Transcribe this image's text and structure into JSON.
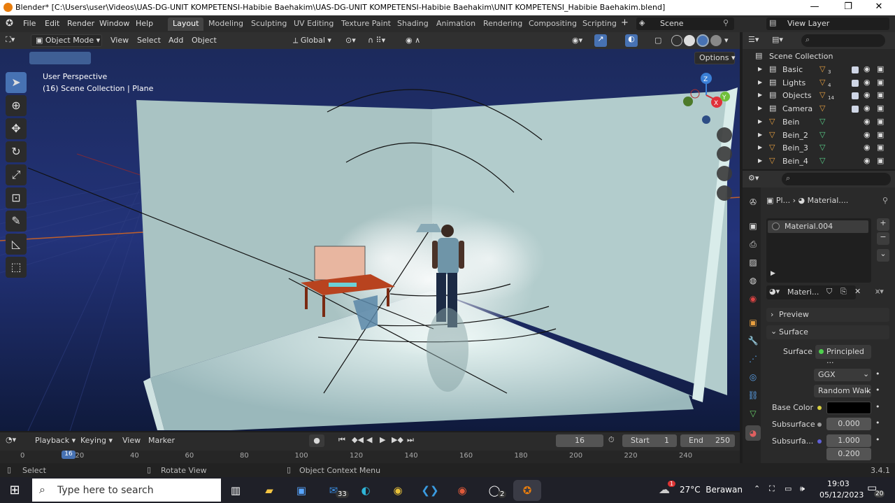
{
  "titlebar": {
    "title": "Blender* [C:\\Users\\user\\Videos\\UAS-DG-UNIT KOMPETENSI-Habibie Baehakim\\UAS-DG-UNIT KOMPETENSI-Habibie Baehakim\\UNIT KOMPETENSI_Habibie Baehakim.blend]",
    "minimize": "—",
    "restore": "❐",
    "close": "✕"
  },
  "menubar": {
    "menus": [
      "File",
      "Edit",
      "Render",
      "Window",
      "Help"
    ],
    "workspaces": [
      "Layout",
      "Modeling",
      "Sculpting",
      "UV Editing",
      "Texture Paint",
      "Shading",
      "Animation",
      "Rendering",
      "Compositing",
      "Scripting"
    ],
    "active_workspace": "Layout",
    "add_workspace": "+",
    "scene": "Scene",
    "view_layer": "View Layer"
  },
  "viewport_header": {
    "mode": "Object Mode",
    "menus": [
      "View",
      "Select",
      "Add",
      "Object"
    ],
    "transform_orientation": "Global",
    "options": "Options"
  },
  "viewport": {
    "view_name": "User Perspective",
    "collection_info": "(16) Scene Collection | Plane",
    "gizmo": {
      "z": "Z",
      "y": "Y",
      "x": "X"
    }
  },
  "outliner": {
    "root": "Scene Collection",
    "items": [
      {
        "name": "Basic",
        "count": "3"
      },
      {
        "name": "Lights",
        "count": "4"
      },
      {
        "name": "Objects",
        "count": "14"
      },
      {
        "name": "Camera",
        "count": ""
      },
      {
        "name": "Bein",
        "count": ""
      },
      {
        "name": "Bein_2",
        "count": ""
      },
      {
        "name": "Bein_3",
        "count": ""
      },
      {
        "name": "Bein_4",
        "count": ""
      }
    ]
  },
  "properties": {
    "breadcrumb_object": "Pl...",
    "breadcrumb_material": "Material....",
    "slot": "Material.004",
    "material_name": "Materi...",
    "preview": "Preview",
    "surface_panel": "Surface",
    "surface_label": "Surface",
    "surface_value": "Principled ...",
    "distribution": "GGX",
    "subsurface_method": "Random Walk",
    "base_color_label": "Base Color",
    "subsurface_label": "Subsurface",
    "subsurface_value": "0.000",
    "subsurface_radius_label": "Subsurfa...",
    "radius_1": "1.000",
    "radius_2": "0.200",
    "colors": {
      "base_color": "#000000"
    }
  },
  "timeline": {
    "menus": [
      "Playback",
      "Keying",
      "View",
      "Marker"
    ],
    "current_frame": "16",
    "start_label": "Start",
    "start": "1",
    "end_label": "End",
    "end": "250",
    "ruler": [
      "0",
      "20",
      "40",
      "60",
      "80",
      "100",
      "120",
      "140",
      "160",
      "180",
      "200",
      "220",
      "240"
    ],
    "playhead": "16"
  },
  "statusbar": {
    "select": "Select",
    "rotate": "Rotate View",
    "context": "Object Context Menu",
    "version": "3.4.1"
  },
  "taskbar": {
    "search_placeholder": "Type here to search",
    "mail_badge": "33",
    "whatsapp_badge": "2",
    "weather": "27°C  Berawan",
    "weather_badge": "1",
    "time": "19:03",
    "date": "05/12/2023",
    "notif": "20"
  }
}
